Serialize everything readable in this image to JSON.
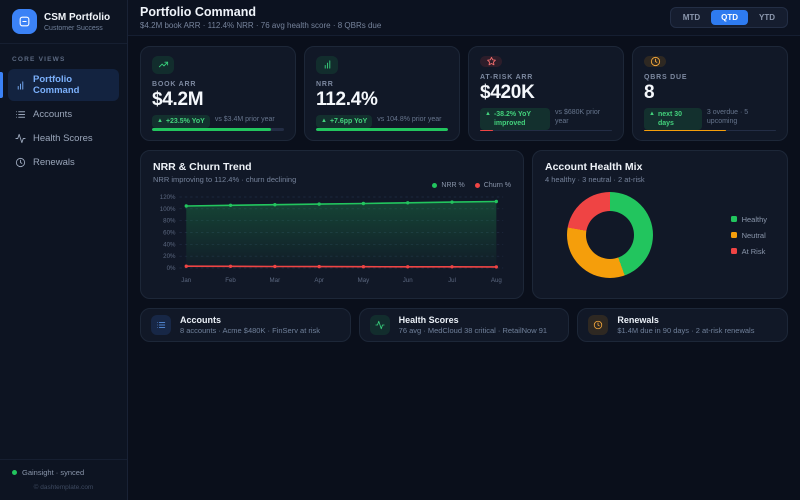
{
  "accent_colors": {
    "blue": "#3b82f6",
    "green": "#22c55e",
    "amber": "#f59e0b",
    "red": "#ef4444"
  },
  "sidebar": {
    "logo_icon": "app-window",
    "logo_title": "CSM Portfolio",
    "logo_subtitle": "Customer Success",
    "section_label": "CORE VIEWS",
    "items": [
      {
        "label": "Portfolio Command",
        "icon": "bar-chart",
        "active": true
      },
      {
        "label": "Accounts",
        "icon": "list",
        "active": false
      },
      {
        "label": "Health Scores",
        "icon": "activity",
        "active": false
      },
      {
        "label": "Renewals",
        "icon": "clock",
        "active": false
      }
    ],
    "sync_status": "Gainsight · synced",
    "copyright": "© dashtemplate.com"
  },
  "header": {
    "title": "Portfolio Command",
    "subtitle": "$4.2M book ARR · 112.4% NRR · 76 avg health score · 8 QBRs due",
    "range_options": [
      "MTD",
      "QTD",
      "YTD"
    ],
    "active_range": "QTD"
  },
  "kpis": [
    {
      "label": "BOOK ARR",
      "value": "$4.2M",
      "icon": "trending-up",
      "tint": "green",
      "badge": "+23.5% YoY",
      "note": "vs $3.4M prior year",
      "bar_pct": 90,
      "bar_color": "#22c55e"
    },
    {
      "label": "NRR",
      "value": "112.4%",
      "icon": "bar-chart",
      "tint": "green",
      "badge": "+7.6pp YoY",
      "note": "vs 104.8% prior year",
      "bar_pct": 100,
      "bar_color": "#22c55e"
    },
    {
      "label": "AT-RISK ARR",
      "value": "$420K",
      "icon": "star-alert",
      "tint": "red",
      "badge": "-38.2% YoY improved",
      "note": "vs $680K prior year",
      "bar_pct": 10,
      "bar_color": "#ef4444"
    },
    {
      "label": "QBRS DUE",
      "value": "8",
      "icon": "clock",
      "tint": "amber",
      "badge": "next 30 days",
      "note": "3 overdue · 5 upcoming",
      "bar_pct": 62,
      "bar_color": "#f59e0b"
    }
  ],
  "chart_data": [
    {
      "type": "line",
      "title": "NRR & Churn Trend",
      "subtitle": "NRR improving to 112.4% · churn declining",
      "x": [
        "Jan",
        "Feb",
        "Mar",
        "Apr",
        "May",
        "Jun",
        "Jul",
        "Aug"
      ],
      "series": [
        {
          "name": "NRR %",
          "color": "#22c55e",
          "area": true,
          "values": [
            104.8,
            105.9,
            107.0,
            108.0,
            109.0,
            110.2,
            111.3,
            112.4
          ]
        },
        {
          "name": "Churn %",
          "color": "#ef4444",
          "area": false,
          "values": [
            3.0,
            2.8,
            2.6,
            2.4,
            2.2,
            2.1,
            2.0,
            1.8
          ]
        }
      ],
      "ylim": [
        0,
        120
      ],
      "ytick_step": 20,
      "ytick_suffix": "%",
      "grid": true,
      "legend_position": "top-right"
    },
    {
      "type": "pie",
      "title": "Account Health Mix",
      "subtitle": "4 healthy · 3 neutral · 2 at-risk",
      "labels": [
        "Healthy",
        "Neutral",
        "At Risk"
      ],
      "values": [
        4,
        3,
        2
      ],
      "colors": [
        "#22c55e",
        "#f59e0b",
        "#ef4444"
      ],
      "legend_position": "right",
      "donut": true
    }
  ],
  "quick_cards": [
    {
      "title": "Accounts",
      "subtitle": "8 accounts · Acme $480K · FinServ at risk",
      "icon": "list",
      "tint": "blue"
    },
    {
      "title": "Health Scores",
      "subtitle": "76 avg · MedCloud 38 critical · RetailNow 91",
      "icon": "activity",
      "tint": "green"
    },
    {
      "title": "Renewals",
      "subtitle": "$1.4M due in 90 days · 2 at-risk renewals",
      "icon": "clock",
      "tint": "amber"
    }
  ]
}
